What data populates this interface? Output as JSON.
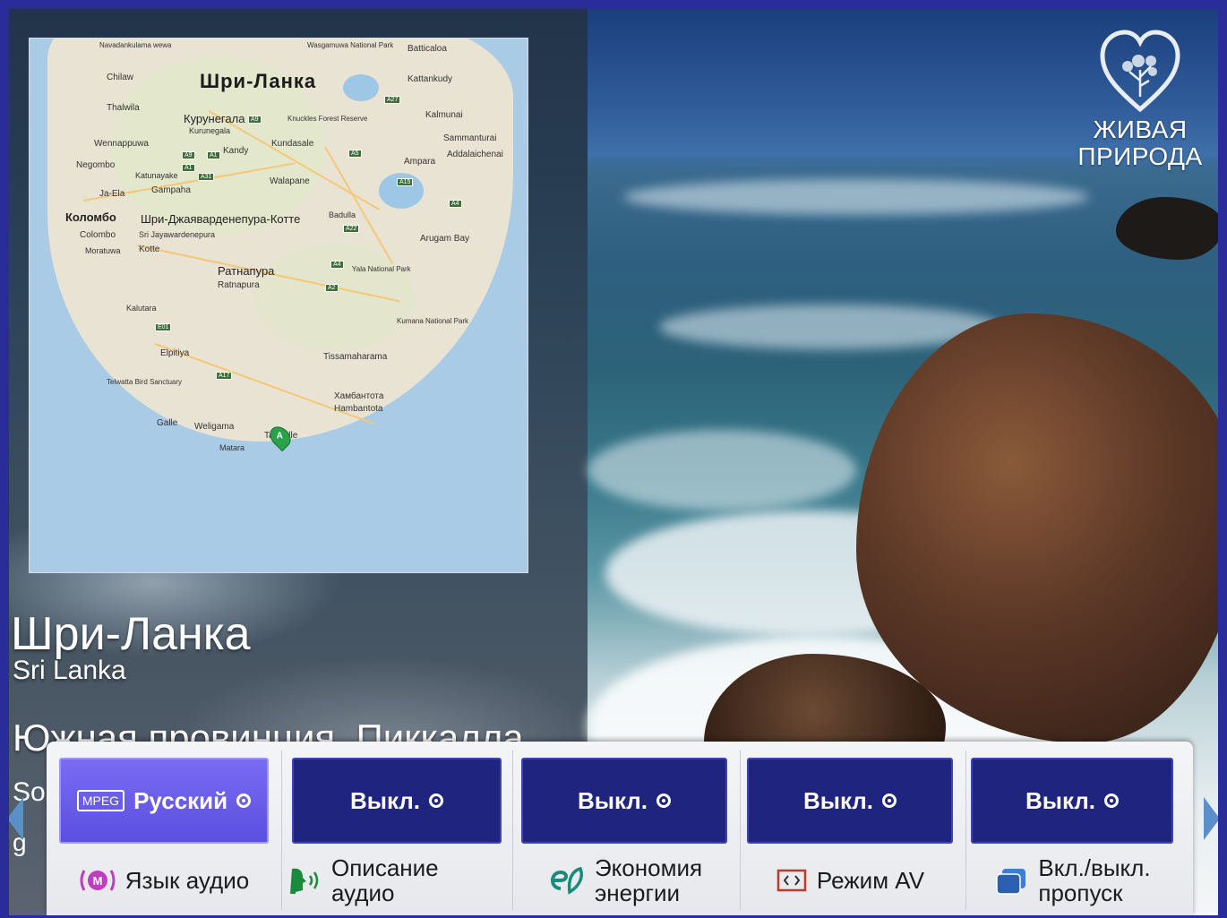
{
  "map": {
    "title": "Шри-Ланка",
    "marker": "A",
    "labels": [
      {
        "text": "Navadankulama wewa"
      },
      {
        "text": "Wasgamuwa National Park"
      },
      {
        "text": "Batticaloa"
      },
      {
        "text": "Chilaw"
      },
      {
        "text": "Kattankudy"
      },
      {
        "text": "Thalwila"
      },
      {
        "text": "Курунегала"
      },
      {
        "text": "Kurunegala"
      },
      {
        "text": "Knuckles Forest Reserve"
      },
      {
        "text": "Kalmunai"
      },
      {
        "text": "Sammanturai"
      },
      {
        "text": "Wennappuwa"
      },
      {
        "text": "Kandy"
      },
      {
        "text": "Kundasale"
      },
      {
        "text": "Addalaichenai"
      },
      {
        "text": "Negombo"
      },
      {
        "text": "Ampara"
      },
      {
        "text": "Katunayake"
      },
      {
        "text": "Walapane"
      },
      {
        "text": "Ja-Ela"
      },
      {
        "text": "Gampaha"
      },
      {
        "text": "Коломбо"
      },
      {
        "text": "Шри-Джаяварденепура-Котте"
      },
      {
        "text": "Badulla"
      },
      {
        "text": "Colombo"
      },
      {
        "text": "Sri Jayawardenepura"
      },
      {
        "text": "Arugam Bay"
      },
      {
        "text": "Moratuwa"
      },
      {
        "text": "Kotte"
      },
      {
        "text": "Ратнапура"
      },
      {
        "text": "Ratnapura"
      },
      {
        "text": "Yala National Park"
      },
      {
        "text": "Kalutara"
      },
      {
        "text": "Kumana National Park"
      },
      {
        "text": "Elpitiya"
      },
      {
        "text": "Tissamaharama"
      },
      {
        "text": "Telwatta Bird Sanctuary"
      },
      {
        "text": "Hambantota"
      },
      {
        "text": "Хамбантота"
      },
      {
        "text": "Galle"
      },
      {
        "text": "Weligama"
      },
      {
        "text": "Tangalle"
      },
      {
        "text": "Matara"
      }
    ],
    "shields": [
      "A9",
      "A9",
      "A1",
      "A5",
      "A1",
      "A31",
      "A27",
      "A4",
      "A15",
      "A22",
      "A4",
      "A2",
      "E01",
      "A17",
      "A4"
    ]
  },
  "logo": {
    "line1": "ЖИВАЯ",
    "line2": "ПРИРОДА"
  },
  "location": {
    "title_ru": "Шри-Ланка",
    "title_en": "Sri Lanka",
    "region": "Южная провинция, Пиккалла",
    "region_partial2": "Sou",
    "region_partial3": "g"
  },
  "menu": {
    "items": [
      {
        "id": "audio-language",
        "value": "Русский",
        "badge": "MPEG",
        "label": "Язык аудио",
        "icon": "mpeg-audio-icon",
        "active": true
      },
      {
        "id": "audio-description",
        "value": "Выкл.",
        "label": "Описание аудио",
        "icon": "audio-description-icon",
        "active": false
      },
      {
        "id": "energy-saving",
        "value": "Выкл.",
        "label_line1": "Экономия",
        "label_line2": "энергии",
        "icon": "eco-icon",
        "active": false
      },
      {
        "id": "av-mode",
        "value": "Выкл.",
        "label": "Режим AV",
        "icon": "av-mode-icon",
        "active": false
      },
      {
        "id": "skip",
        "value": "Выкл.",
        "label_line1": "Вкл./выкл.",
        "label_line2": "пропуск",
        "icon": "skip-icon",
        "active": false
      }
    ]
  },
  "colors": {
    "button_bg": "#1f247f",
    "button_active": "#5a4fe0",
    "menu_bg": "#e9eaee",
    "map_water": "#a9cbe6",
    "map_land": "#e9e3d3"
  }
}
